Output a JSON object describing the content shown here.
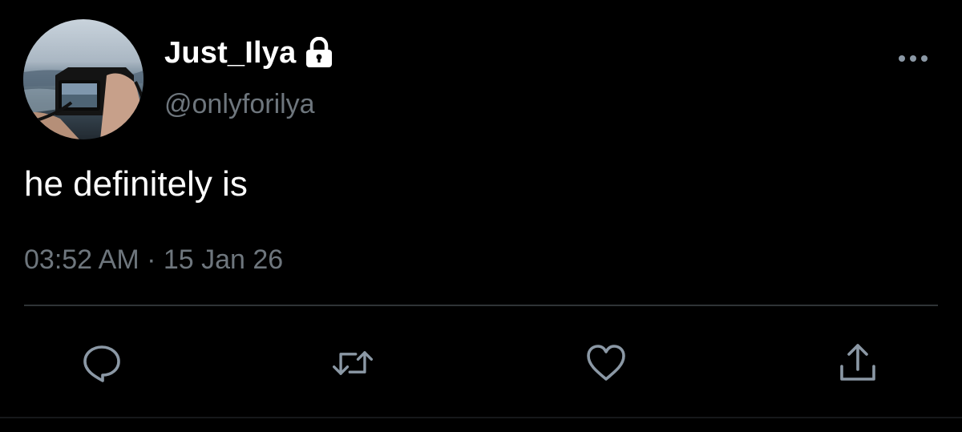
{
  "tweet": {
    "display_name": "Just_Ilya",
    "handle": "@onlyforilya",
    "text": "he definitely is",
    "timestamp": "03:52 AM · 15 Jan 26",
    "protected": true
  },
  "actions": {
    "reply": "reply-icon",
    "retweet": "retweet-icon",
    "like": "heart-icon",
    "share": "share-icon"
  },
  "colors": {
    "background": "#000000",
    "primary_text": "#ffffff",
    "secondary_text": "#6e767d",
    "icon": "#8b98a5",
    "divider": "#2f3336"
  }
}
